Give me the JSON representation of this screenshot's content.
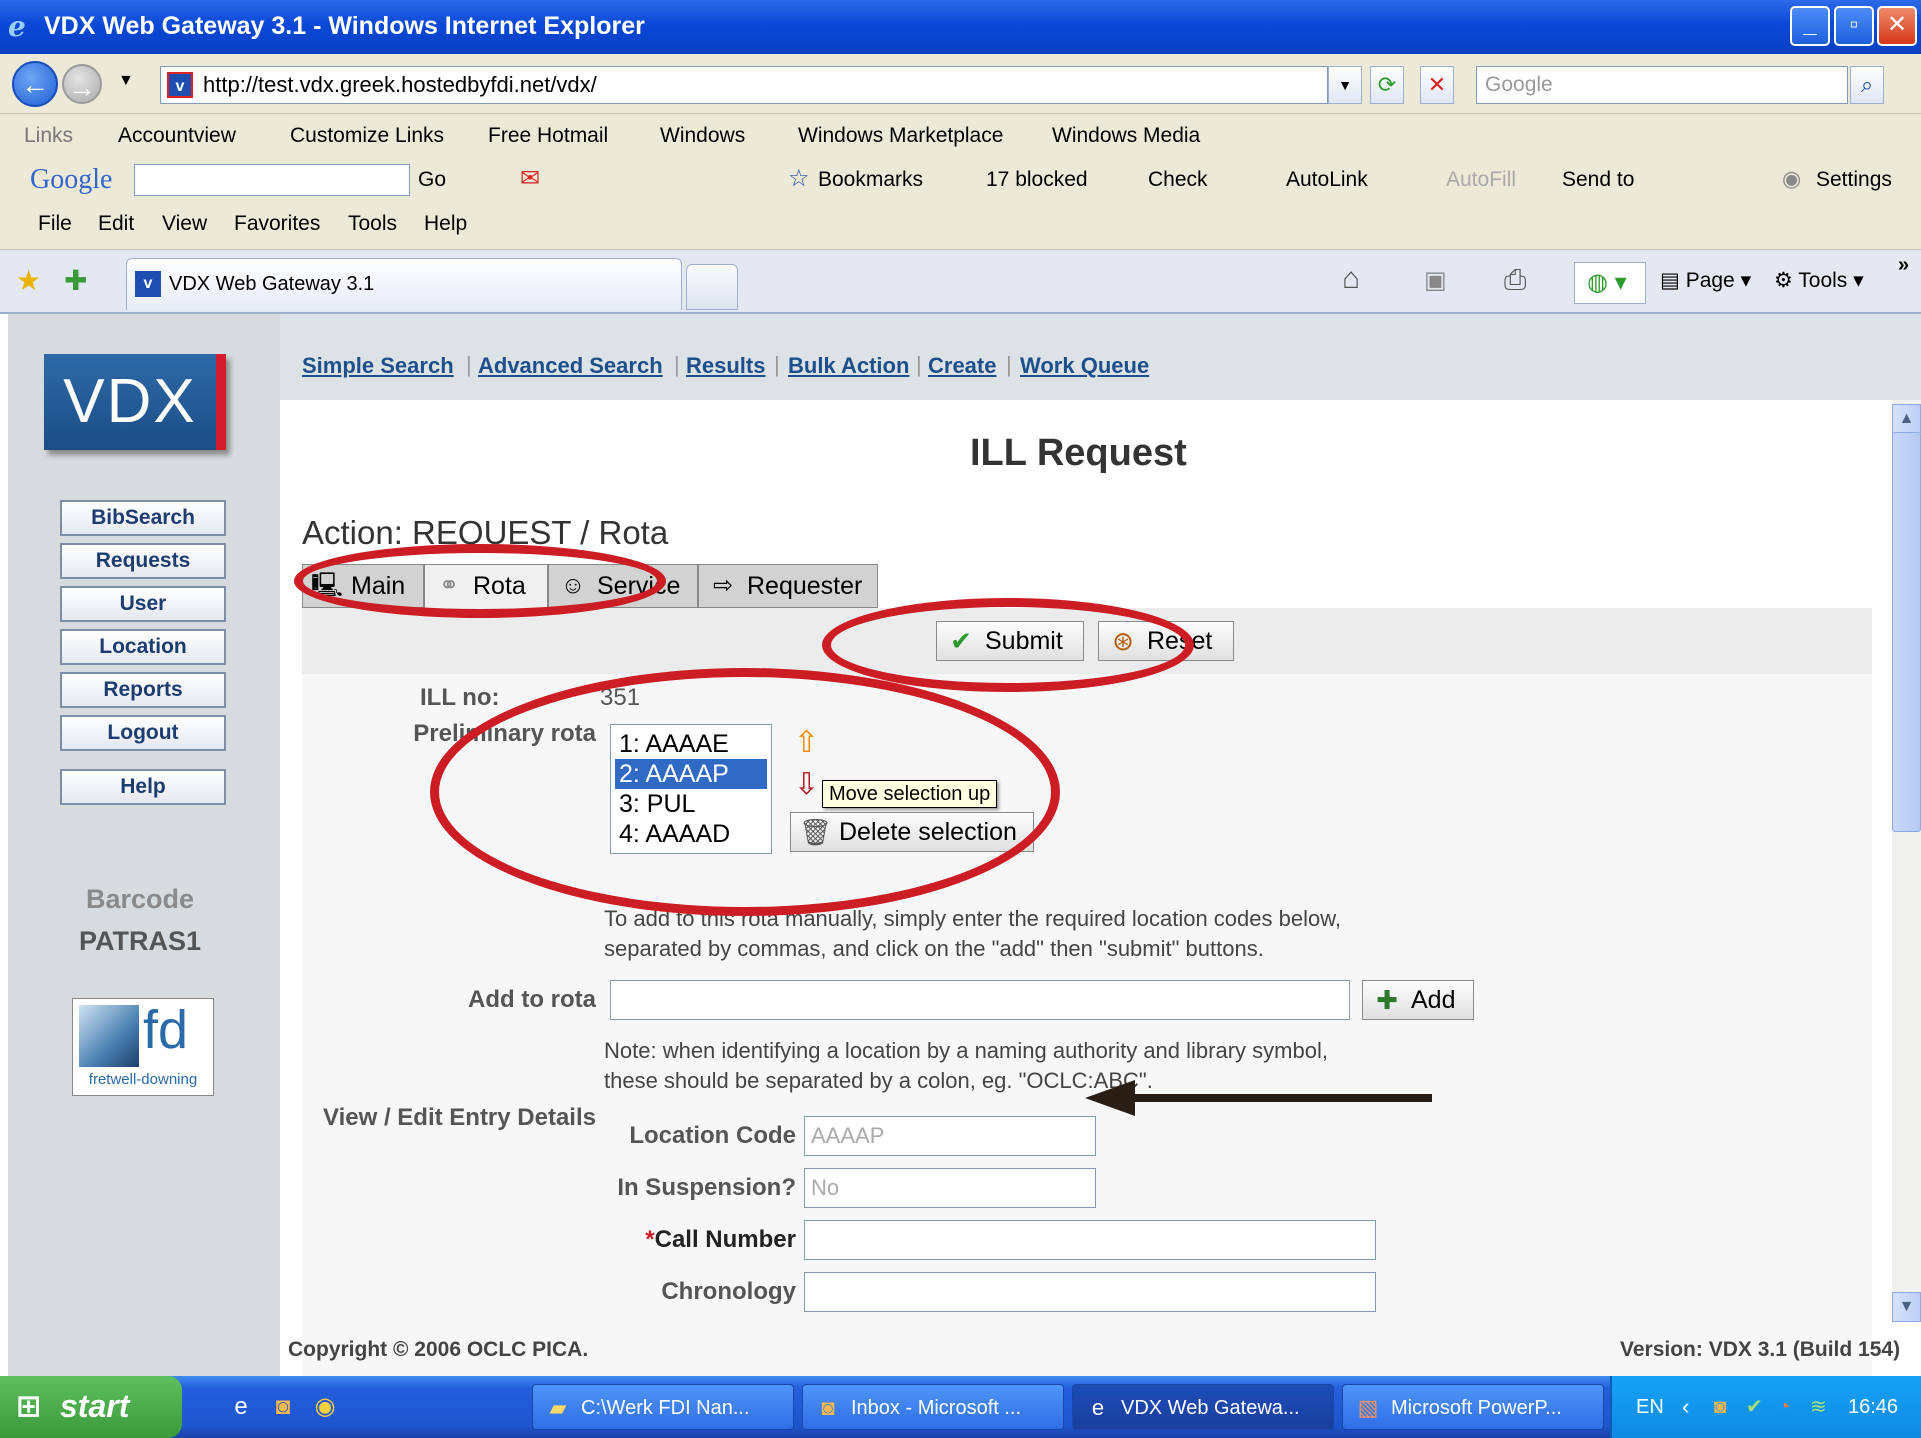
{
  "window": {
    "title": "VDX Web Gateway 3.1 - Windows Internet Explorer",
    "minimize": "_",
    "maximize": "▫",
    "close": "✕"
  },
  "address_bar": {
    "url": "http://test.vdx.greek.hostedbyfdi.net/vdx/",
    "search_placeholder": "Google"
  },
  "links_bar": {
    "label": "Links",
    "items": [
      "Accountview",
      "Customize Links",
      "Free Hotmail",
      "Windows",
      "Windows Marketplace",
      "Windows Media"
    ]
  },
  "google_toolbar": {
    "brand": "Google",
    "go": "Go",
    "bookmarks": "Bookmarks",
    "blocked": "17 blocked",
    "check": "Check",
    "autolink": "AutoLink",
    "autofill": "AutoFill",
    "send_to": "Send to",
    "settings": "Settings"
  },
  "menu": [
    "File",
    "Edit",
    "View",
    "Favorites",
    "Tools",
    "Help"
  ],
  "browser_tab": {
    "title": "VDX Web Gateway 3.1",
    "page_label": "Page",
    "tools_label": "Tools"
  },
  "app": {
    "logo": "VDX",
    "nav_links": [
      "Simple Search",
      "Advanced Search",
      "Results",
      "Bulk Action",
      "Create",
      "Work Queue"
    ],
    "side_buttons": [
      "BibSearch",
      "Requests",
      "User",
      "Location",
      "Reports",
      "Logout",
      "Help"
    ],
    "barcode_label": "Barcode",
    "barcode_value": "PATRAS1",
    "fd_logo": "fd",
    "fd_brand": "fretwell-downing",
    "page_title": "ILL Request",
    "action_title": "Action: REQUEST / Rota",
    "tabs": [
      "Main",
      "Rota",
      "Service",
      "Requester"
    ],
    "submit": "Submit",
    "reset": "Reset",
    "ill_label": "ILL no:",
    "ill_value": "351",
    "prelim_label": "Preliminary rota",
    "rota_items": [
      "1: AAAAE",
      "2: AAAAP",
      "3: PUL",
      "4: AAAAD"
    ],
    "selected_index": 1,
    "tooltip": "Move selection up",
    "delete_selection": "Delete selection",
    "add_help_1": "To add to this rota manually, simply enter the required location codes below,",
    "add_help_2": "separated by commas, and click on the \"add\" then \"submit\" buttons.",
    "add_to_rota_label": "Add to rota",
    "add_button": "Add",
    "note_1": "Note: when identifying a location by a naming authority and library symbol,",
    "note_2": "these should be separated by a colon, eg. \"OCLC:ABC\".",
    "view_edit_label": "View / Edit Entry Details",
    "location_code_label": "Location Code",
    "location_code_value": "AAAAP",
    "suspension_label": "In Suspension?",
    "suspension_value": "No",
    "required_mark": "*",
    "call_number_label": "Call Number",
    "chronology_label": "Chronology",
    "copyright": "Copyright © 2006 OCLC PICA.",
    "version": "Version: VDX 3.1 (Build 154)"
  },
  "taskbar": {
    "start": "start",
    "tasks": [
      "C:\\Werk FDI Nan...",
      "Inbox - Microsoft ...",
      "VDX Web Gatewa...",
      "Microsoft PowerP..."
    ],
    "lang": "EN",
    "clock": "16:46"
  },
  "colors": {
    "annotation_ring": "#cc1c24",
    "arrow": "#2a1e14",
    "link": "#1c4f8c",
    "selection": "#316ac5"
  }
}
